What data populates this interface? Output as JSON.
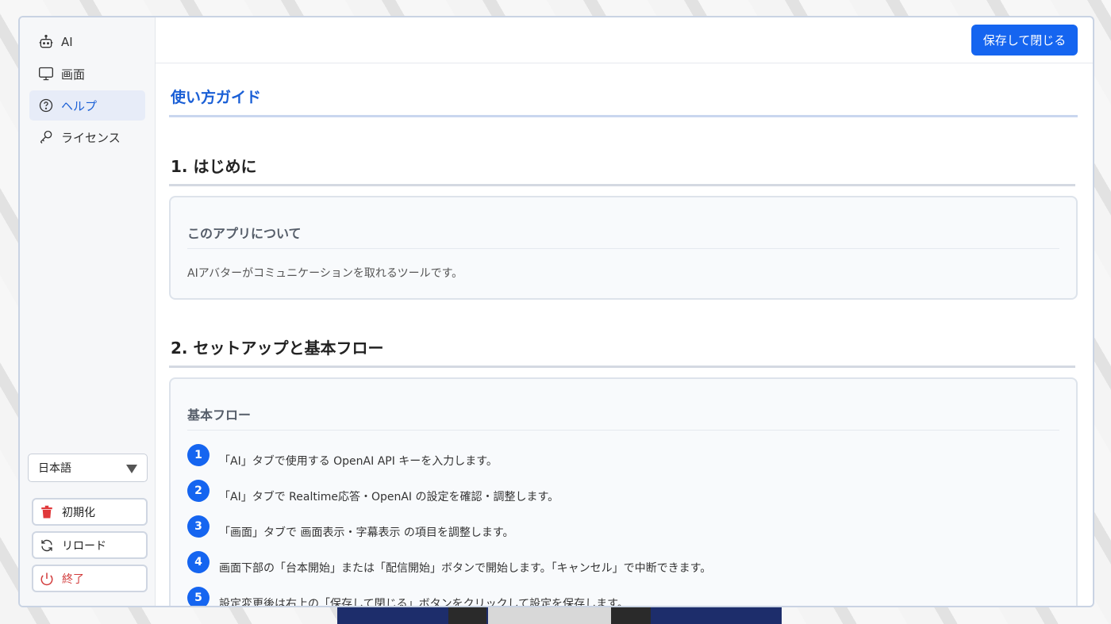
{
  "sidebar": {
    "items": [
      {
        "label": "AI",
        "icon": "robot-icon",
        "active": false
      },
      {
        "label": "画面",
        "icon": "monitor-icon",
        "active": false
      },
      {
        "label": "ヘルプ",
        "icon": "help-circle-icon",
        "active": true
      },
      {
        "label": "ライセンス",
        "icon": "key-icon",
        "active": false
      }
    ],
    "language": "日本語",
    "buttons": {
      "init": "初期化",
      "reload": "リロード",
      "quit": "終了"
    }
  },
  "header": {
    "save_label": "保存して閉じる"
  },
  "main": {
    "title": "使い方ガイド",
    "section1": {
      "title": "1. はじめに",
      "card_title": "このアプリについて",
      "card_text": "AIアバターがコミュニケーションを取れるツールです。"
    },
    "section2": {
      "title": "2. セットアップと基本フロー",
      "card_title": "基本フロー",
      "steps": [
        {
          "num": "1",
          "text": "「AI」タブで使用する OpenAI API キーを入力します。"
        },
        {
          "num": "2",
          "text": "「AI」タブで Realtime応答・OpenAI の設定を確認・調整します。"
        },
        {
          "num": "3",
          "text": "「画面」タブで 画面表示・字幕表示 の項目を調整します。"
        },
        {
          "num": "4",
          "text": "画面下部の「台本開始」または「配信開始」ボタンで開始します。「キャンセル」で中断できます。"
        },
        {
          "num": "5",
          "text": "設定変更後は右上の「保存して閉じる」ボタンをクリックして設定を保存します。"
        }
      ]
    }
  },
  "colors": {
    "accent": "#1565f0",
    "danger": "#d23b3b"
  }
}
